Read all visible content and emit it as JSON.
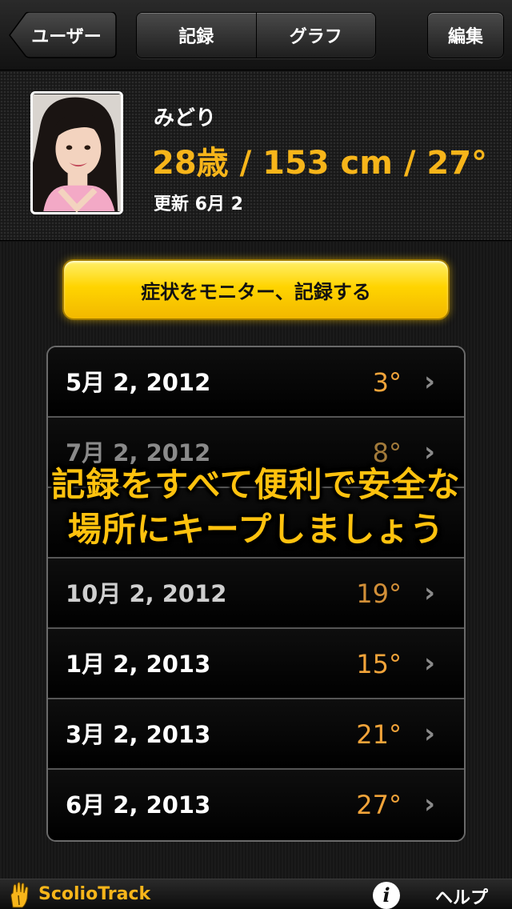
{
  "nav": {
    "back_label": "ユーザー",
    "tabs": [
      {
        "label": "記録"
      },
      {
        "label": "グラフ"
      }
    ],
    "edit_label": "編集"
  },
  "profile": {
    "name": "みどり",
    "stats": "28歳 / 153 cm / 27°",
    "updated": "更新 6月 2"
  },
  "monitor_button": "症状をモニター、記録する",
  "records": [
    {
      "date": "5月 2, 2012",
      "angle": "3°"
    },
    {
      "date": "7月 2, 2012",
      "angle": "8°"
    },
    {
      "date": "",
      "angle": ""
    },
    {
      "date": "10月 2, 2012",
      "angle": "19°"
    },
    {
      "date": "1月 2, 2013",
      "angle": "15°"
    },
    {
      "date": "3月 2, 2013",
      "angle": "21°"
    },
    {
      "date": "6月 2, 2013",
      "angle": "27°"
    }
  ],
  "promo": {
    "line1": "記録をすべて便利で安全な",
    "line2": "場所にキープしましょう"
  },
  "footer": {
    "app_name": "ScolioTrack",
    "help_label": "ヘルプ",
    "info_icon": "i"
  },
  "colors": {
    "accent": "#f7b51a",
    "angle": "#f2a43a",
    "button": "#ffd400"
  }
}
